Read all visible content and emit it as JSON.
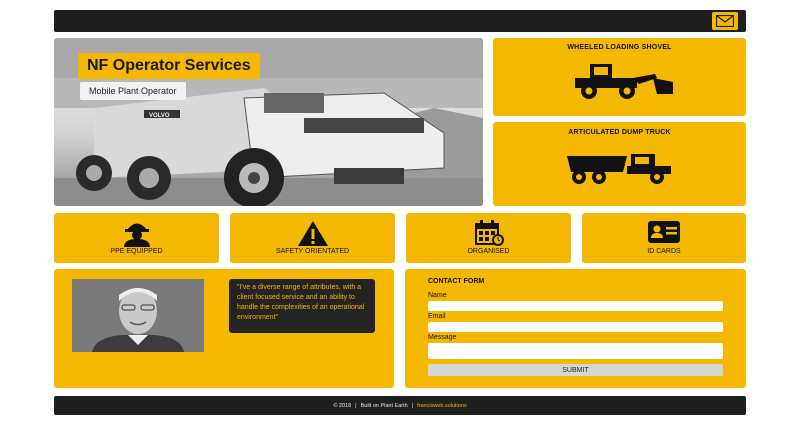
{
  "header": {
    "mail_icon": "envelope-icon"
  },
  "hero": {
    "title": "NF Operator Services",
    "subtitle": "Mobile Plant Operator",
    "truck_badge": "VOLVO"
  },
  "machines": [
    {
      "title": "WHEELED LOADING SHOVEL",
      "icon": "wheel-loader-icon"
    },
    {
      "title": "ARTICULATED DUMP TRUCK",
      "icon": "dump-truck-icon"
    }
  ],
  "features": [
    {
      "label": "PPE EQUIPPED",
      "icon": "hard-hat-worker-icon"
    },
    {
      "label": "SAFETY ORIENTATED",
      "icon": "warning-icon"
    },
    {
      "label": "ORGANISED",
      "icon": "calendar-clock-icon"
    },
    {
      "label": "ID CARDS",
      "icon": "id-card-icon"
    }
  ],
  "bio": {
    "quote": "\"I've a diverse range of attributes, with a client focused service and an ability to handle the complexities of an operational environment\""
  },
  "contact": {
    "title": "CONTACT FORM",
    "name_label": "Name",
    "email_label": "Email",
    "message_label": "Message",
    "submit_label": "SUBMIT"
  },
  "footer": {
    "copyright": "© 2018",
    "sep1": "|",
    "built": "Built on Plant Earth",
    "sep2": "|",
    "link": "francisweb.solutions"
  },
  "colors": {
    "accent": "#f5b800",
    "dark": "#1f1f1f"
  }
}
